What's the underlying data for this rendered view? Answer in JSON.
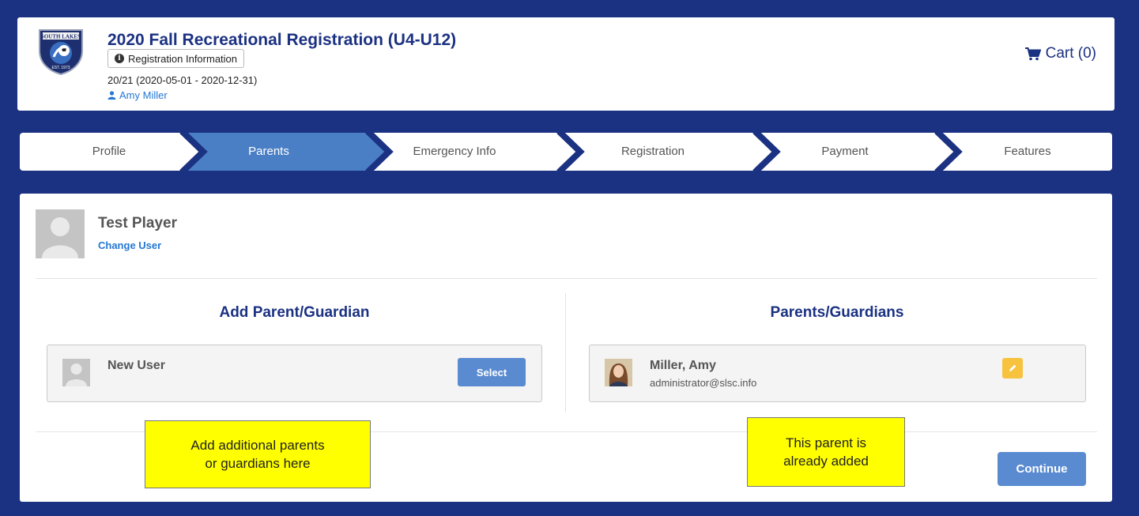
{
  "header": {
    "title": "2020 Fall Recreational Registration (U4-U12)",
    "info_button": "Registration Information",
    "season": "20/21 (2020-05-01 - 2020-12-31)",
    "user": "Amy Miller",
    "cart": "Cart (0)"
  },
  "steps": [
    {
      "label": "Profile",
      "active": false
    },
    {
      "label": "Parents",
      "active": true
    },
    {
      "label": "Emergency Info",
      "active": false
    },
    {
      "label": "Registration",
      "active": false
    },
    {
      "label": "Payment",
      "active": false
    },
    {
      "label": "Features",
      "active": false
    }
  ],
  "player": {
    "name": "Test Player",
    "change_user": "Change User"
  },
  "add_parent": {
    "heading": "Add Parent/Guardian",
    "new_user": "New User",
    "select_button": "Select"
  },
  "parents": {
    "heading": "Parents/Guardians",
    "items": [
      {
        "name": "Miller, Amy",
        "email": "administrator@slsc.info"
      }
    ]
  },
  "continue_button": "Continue",
  "annotations": {
    "add_note_line1": "Add additional parents",
    "add_note_line2": "or guardians here",
    "added_note_line1": "This parent is",
    "added_note_line2": "already added"
  },
  "colors": {
    "background": "#1b3182",
    "active_step": "#4a7fc6",
    "button": "#5a8bd0",
    "edit_button": "#f7c23d",
    "link": "#2477d3",
    "note": "#ffff00"
  },
  "icons": {
    "logo": "south-lakes-sc-crest",
    "info": "info-circle-icon",
    "user": "user-icon",
    "cart": "shopping-cart-icon",
    "edit": "pencil-icon"
  }
}
